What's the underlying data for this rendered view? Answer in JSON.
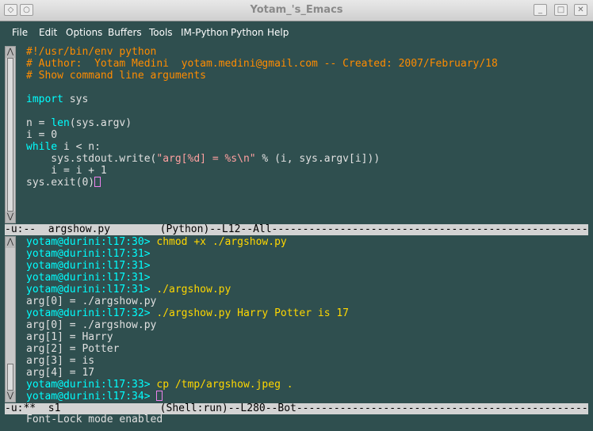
{
  "window": {
    "title": "Yotam_'s_Emacs"
  },
  "menu": [
    "File",
    "Edit",
    "Options",
    "Buffers",
    "Tools",
    "IM-Python",
    "Python",
    "Help"
  ],
  "colors": {
    "background": "#2f4f4f",
    "comment": "#ff8c00",
    "keyword": "#00ffff",
    "string": "#ffa0a0",
    "modeline": "#d3d3d3"
  },
  "editor": {
    "lines": [
      [
        {
          "t": "#!/usr/bin/env python",
          "c": "comment"
        }
      ],
      [
        {
          "t": "# Author:  Yotam Medini  yotam.medini@gmail.com -- Created: 2007/February/18",
          "c": "comment"
        }
      ],
      [
        {
          "t": "# Show command line arguments",
          "c": "comment"
        }
      ],
      [],
      [
        {
          "t": "import",
          "c": "keyword"
        },
        {
          "t": " sys",
          "c": "plain"
        }
      ],
      [],
      [
        {
          "t": "n = ",
          "c": "plain"
        },
        {
          "t": "len",
          "c": "builtin"
        },
        {
          "t": "(sys.argv)",
          "c": "plain"
        }
      ],
      [
        {
          "t": "i = 0",
          "c": "plain"
        }
      ],
      [
        {
          "t": "while",
          "c": "keyword"
        },
        {
          "t": " i < n:",
          "c": "plain"
        }
      ],
      [
        {
          "t": "    sys.stdout.write(",
          "c": "plain"
        },
        {
          "t": "\"arg[%d] = %s\\n\"",
          "c": "string"
        },
        {
          "t": " % (i, sys.argv[i]))",
          "c": "plain"
        }
      ],
      [
        {
          "t": "    i = i + 1",
          "c": "plain"
        }
      ],
      [
        {
          "t": "sys.exit(0)",
          "c": "plain"
        },
        {
          "t": "",
          "c": "cursor"
        }
      ]
    ],
    "modeline": "-u:--  argshow.py        (Python)--L12--All-----------------------------------------------------------"
  },
  "shell": {
    "lines": [
      [
        {
          "t": "yotam@durini:l17:30>",
          "c": "prompt"
        },
        {
          "t": " chmod +x ./argshow.py",
          "c": "cmd"
        }
      ],
      [
        {
          "t": "yotam@durini:l17:31>",
          "c": "prompt"
        }
      ],
      [
        {
          "t": "yotam@durini:l17:31>",
          "c": "prompt"
        }
      ],
      [
        {
          "t": "yotam@durini:l17:31>",
          "c": "prompt"
        }
      ],
      [
        {
          "t": "yotam@durini:l17:31>",
          "c": "prompt"
        },
        {
          "t": " ./argshow.py",
          "c": "cmd"
        }
      ],
      [
        {
          "t": "arg[0] = ./argshow.py",
          "c": "out"
        }
      ],
      [
        {
          "t": "yotam@durini:l17:32>",
          "c": "prompt"
        },
        {
          "t": " ./argshow.py Harry Potter is 17",
          "c": "cmd"
        }
      ],
      [
        {
          "t": "arg[0] = ./argshow.py",
          "c": "out"
        }
      ],
      [
        {
          "t": "arg[1] = Harry",
          "c": "out"
        }
      ],
      [
        {
          "t": "arg[2] = Potter",
          "c": "out"
        }
      ],
      [
        {
          "t": "arg[3] = is",
          "c": "out"
        }
      ],
      [
        {
          "t": "arg[4] = 17",
          "c": "out"
        }
      ],
      [
        {
          "t": "yotam@durini:l17:33>",
          "c": "prompt"
        },
        {
          "t": " cp /tmp/argshow.jpeg .",
          "c": "cmd"
        }
      ],
      [
        {
          "t": "yotam@durini:l17:34>",
          "c": "prompt"
        },
        {
          "t": " ",
          "c": "plain"
        },
        {
          "t": "",
          "c": "cursor"
        }
      ]
    ],
    "modeline": "-u:**  s1                (Shell:run)--L280--Bot------------------------------------------------------"
  },
  "minibuffer": "Font-Lock mode enabled"
}
